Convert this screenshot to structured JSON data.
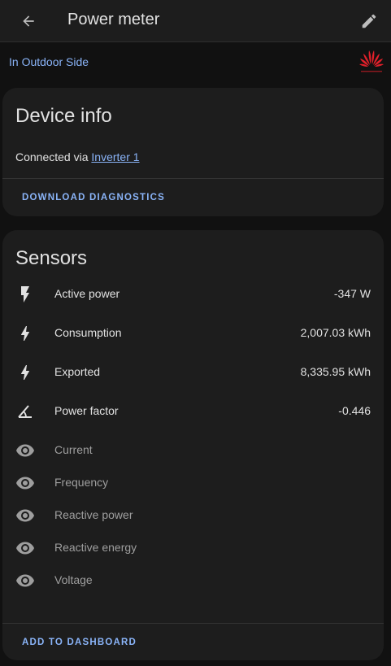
{
  "header": {
    "title": "Power meter"
  },
  "area": {
    "label": "In Outdoor Side"
  },
  "device_info": {
    "title": "Device info",
    "connected_prefix": "Connected via ",
    "connected_link": "Inverter 1",
    "download_label": "DOWNLOAD DIAGNOSTICS"
  },
  "sensors": {
    "title": "Sensors",
    "items": [
      {
        "name": "Active power",
        "value": "-347 W",
        "icon": "lightning-bolt-filled-icon"
      },
      {
        "name": "Consumption",
        "value": "2,007.03 kWh",
        "icon": "lightning-bolt-icon"
      },
      {
        "name": "Exported",
        "value": "8,335.95 kWh",
        "icon": "lightning-bolt-icon"
      },
      {
        "name": "Power factor",
        "value": "-0.446",
        "icon": "angle-acute-icon"
      },
      {
        "name": "Current",
        "value": "",
        "icon": "eye-icon"
      },
      {
        "name": "Frequency",
        "value": "",
        "icon": "eye-icon"
      },
      {
        "name": "Reactive power",
        "value": "",
        "icon": "eye-icon"
      },
      {
        "name": "Reactive energy",
        "value": "",
        "icon": "eye-icon"
      },
      {
        "name": "Voltage",
        "value": "",
        "icon": "eye-icon"
      }
    ],
    "add_label": "ADD TO DASHBOARD"
  },
  "colors": {
    "accent": "#8ab4f8",
    "brand": "#e0202a",
    "background": "#111111",
    "card": "#1d1d1d"
  }
}
